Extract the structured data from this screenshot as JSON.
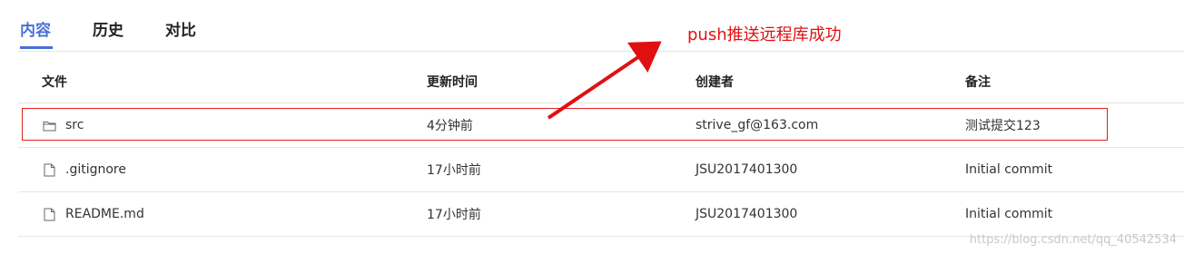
{
  "tabs": [
    {
      "label": "内容",
      "active": true
    },
    {
      "label": "历史",
      "active": false
    },
    {
      "label": "对比",
      "active": false
    }
  ],
  "table": {
    "headers": {
      "file": "文件",
      "time": "更新时间",
      "author": "创建者",
      "note": "备注"
    },
    "rows": [
      {
        "icon": "folder-icon",
        "name": "src",
        "time": "4分钟前",
        "author": "strive_gf@163.com",
        "note": "测试提交123"
      },
      {
        "icon": "file-icon",
        "name": ".gitignore",
        "time": "17小时前",
        "author": "JSU2017401300",
        "note": "Initial commit"
      },
      {
        "icon": "file-icon",
        "name": "README.md",
        "time": "17小时前",
        "author": "JSU2017401300",
        "note": "Initial commit"
      }
    ]
  },
  "annotation": {
    "text": "push推送远程库成功",
    "color": "#e01010"
  },
  "watermark": "https://blog.csdn.net/qq_40542534",
  "colors": {
    "accent": "#4a6fd8",
    "highlight": "#e02020"
  }
}
